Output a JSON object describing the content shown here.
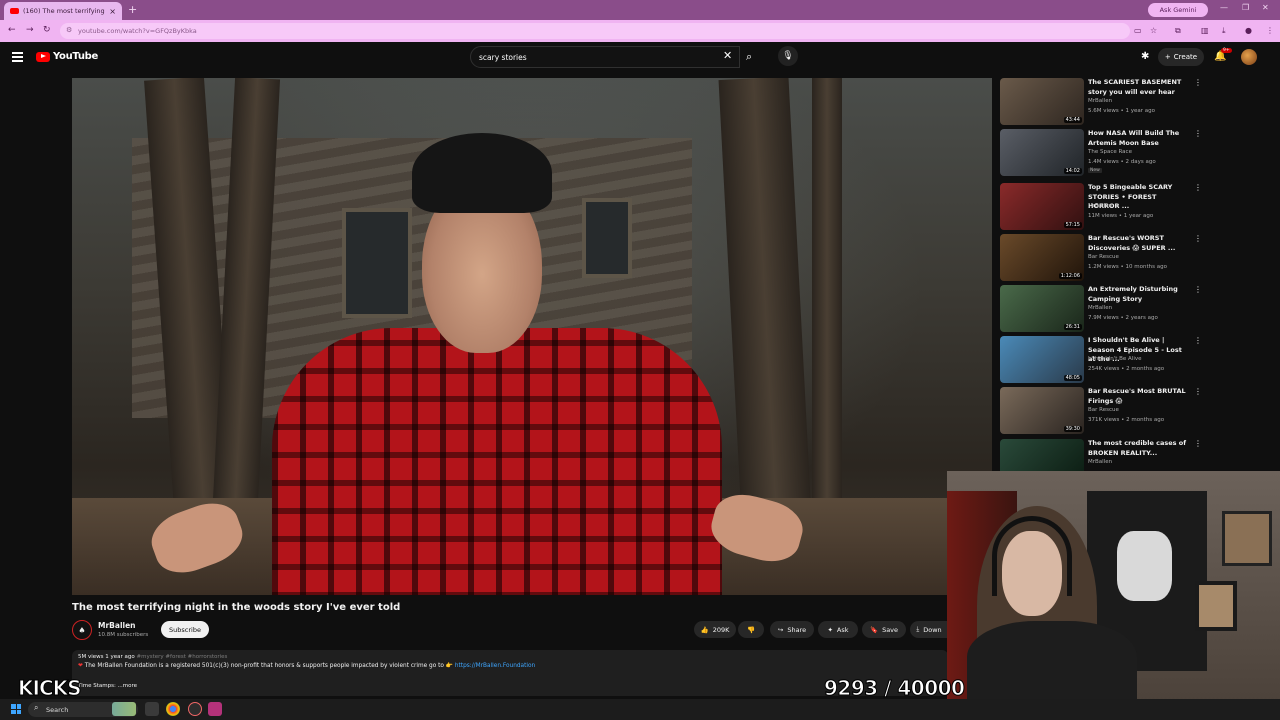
{
  "browser": {
    "tab_title": "(160) The most terrifying ni...",
    "tab_close": "×",
    "new_tab": "+",
    "gemini_label": "Ask Gemini",
    "url": "youtube.com/watch?v=GFQzByKbka"
  },
  "youtube": {
    "logo_text": "YouTube",
    "search_value": "scary stories",
    "create_label": "Create",
    "notification_count": "9+"
  },
  "video": {
    "title": "The most terrifying night in the woods story I've ever told",
    "channel_name": "MrBallen",
    "channel_subs": "10.8M subscribers",
    "subscribe_label": "Subscribe",
    "like_count": "209K",
    "share_label": "Share",
    "ask_label": "Ask",
    "save_label": "Save",
    "download_label": "Down",
    "desc_stats": "5M views  1 year ago",
    "desc_tags": "#mystery #forest #horrorstories",
    "desc_line": "The MrBallen Foundation is a registered 501(c)(3) non-profit that honors & supports people impacted by violent crime go to 👉",
    "desc_link": "https://MrBallen.Foundation",
    "desc_more": "Time Stamps: ...more"
  },
  "recommendations": [
    {
      "title": "The SCARIEST BASEMENT story you will ever hear",
      "channel": "MrBallen",
      "meta": "5.6M views • 1 year ago",
      "duration": "43:44",
      "badge": ""
    },
    {
      "title": "How NASA Will Build The Artemis Moon Base",
      "channel": "The Space Race",
      "meta": "1.4M views • 2 days ago",
      "duration": "14:02",
      "badge": "New"
    },
    {
      "title": "Top 5 Bingeable SCARY STORIES • FOREST HORROR ...",
      "channel": "MrBallen",
      "meta": "11M views • 1 year ago",
      "duration": "57:15",
      "badge": ""
    },
    {
      "title": "Bar Rescue's WORST Discoveries 😱 SUPER ...",
      "channel": "Bar Rescue",
      "meta": "1.2M views • 10 months ago",
      "duration": "1:12:06",
      "badge": ""
    },
    {
      "title": "An Extremely Disturbing Camping Story",
      "channel": "MrBallen",
      "meta": "7.9M views • 2 years ago",
      "duration": "26:31",
      "badge": ""
    },
    {
      "title": "I Shouldn't Be Alive | Season 4 Episode 5 - Lost at the ...",
      "channel": "I Shouldn't Be Alive",
      "meta": "254K views • 2 months ago",
      "duration": "48:05",
      "badge": ""
    },
    {
      "title": "Bar Rescue's Most BRUTAL Firings 😱",
      "channel": "Bar Rescue",
      "meta": "371K views • 2 months ago",
      "duration": "39:30",
      "badge": ""
    },
    {
      "title": "The most credible cases of BROKEN REALITY...",
      "channel": "MrBallen",
      "meta": "",
      "duration": "",
      "badge": ""
    }
  ],
  "overlays": {
    "kicks_label": "KICKS",
    "counter": "9293 / 40000"
  },
  "taskbar": {
    "search_label": "Search"
  },
  "colors": {
    "tabbar": "#8a4d8a",
    "address_bar": "#f0b4f2",
    "youtube_red": "#ff0000",
    "page_bg": "#0f0f0f",
    "link": "#3ea6ff"
  }
}
